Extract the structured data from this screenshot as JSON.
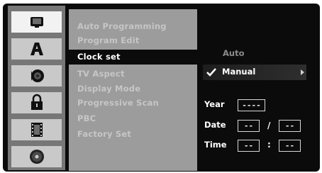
{
  "left_icons": [
    {
      "icon": "tv-icon"
    },
    {
      "icon": "language-a-icon"
    },
    {
      "icon": "speaker-icon"
    },
    {
      "icon": "lock-icon"
    },
    {
      "icon": "film-icon"
    },
    {
      "icon": "disc-icon"
    }
  ],
  "menu": {
    "items": [
      {
        "label": "Auto Programming"
      },
      {
        "label": "Program Edit"
      },
      {
        "label": "Clock set"
      },
      {
        "label": "TV Aspect"
      },
      {
        "label": "Display Mode"
      },
      {
        "label": "Progressive Scan"
      },
      {
        "label": "PBC"
      },
      {
        "label": "Factory Set"
      }
    ],
    "selected_index": 2
  },
  "clock": {
    "option_auto": "Auto",
    "option_manual": "Manual",
    "year_label": "Year",
    "year_value": "----",
    "date_label": "Date",
    "date_month": "--",
    "date_sep": "/",
    "date_day": "--",
    "time_label": "Time",
    "time_hour": "--",
    "time_sep": ":",
    "time_min": "--"
  },
  "colors": {
    "screen_bg": "#0b0b0b",
    "menu_bg": "#9c9c9c",
    "icon_col_bg": "#777777"
  }
}
